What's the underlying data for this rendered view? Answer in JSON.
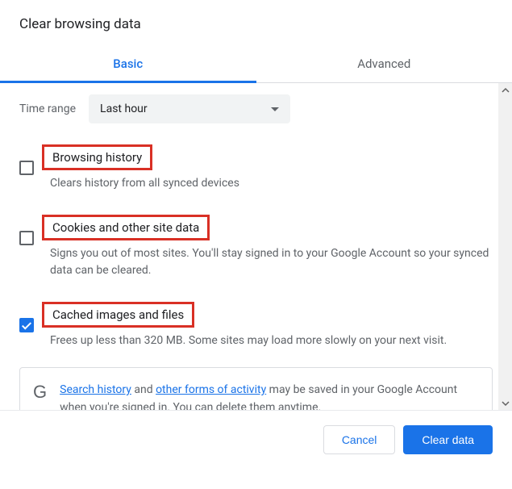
{
  "title": "Clear browsing data",
  "tabs": {
    "basic": "Basic",
    "advanced": "Advanced"
  },
  "timeRange": {
    "label": "Time range",
    "value": "Last hour"
  },
  "items": [
    {
      "title": "Browsing history",
      "desc": "Clears history from all synced devices",
      "checked": false
    },
    {
      "title": "Cookies and other site data",
      "desc": "Signs you out of most sites. You'll stay signed in to your Google Account so your synced data can be cleared.",
      "checked": false
    },
    {
      "title": "Cached images and files",
      "desc": "Frees up less than 320 MB. Some sites may load more slowly on your next visit.",
      "checked": true
    }
  ],
  "notice": {
    "link1": "Search history",
    "mid1": " and ",
    "link2": "other forms of activity",
    "tail": " may be saved in your Google Account when you're signed in. You can delete them anytime."
  },
  "buttons": {
    "cancel": "Cancel",
    "clear": "Clear data"
  }
}
